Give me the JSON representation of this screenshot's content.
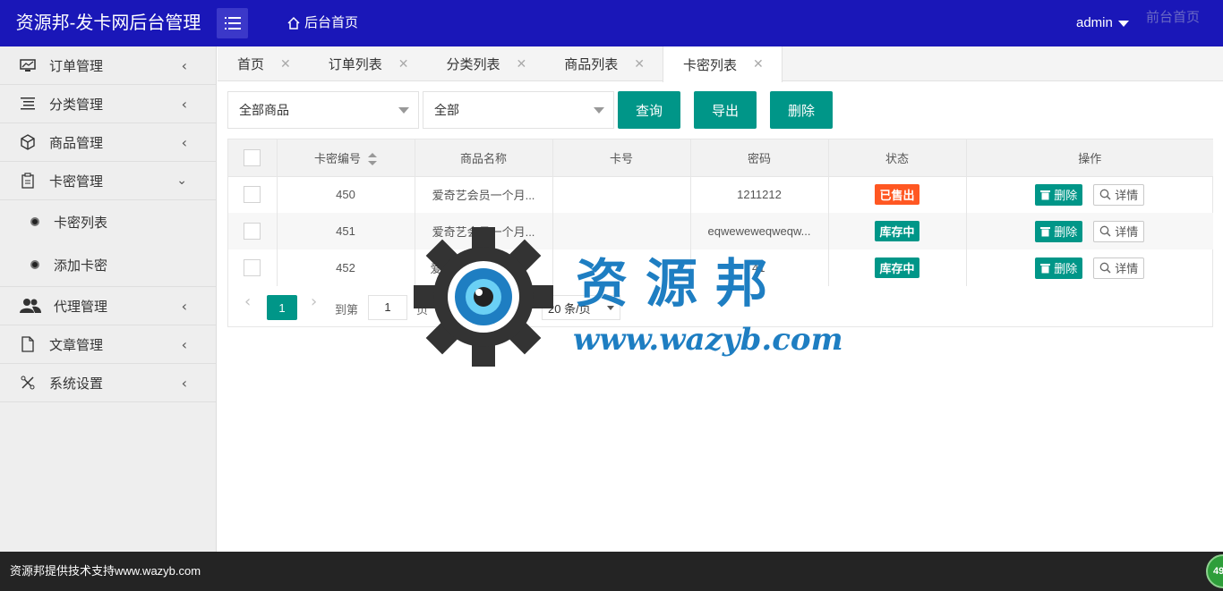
{
  "header": {
    "logo_text": "资源邦-发卡网后台管理",
    "home_label": "后台首页",
    "user_name": "admin",
    "front_link": "前台首页"
  },
  "sidebar": {
    "items": [
      {
        "label": "订单管理",
        "icon": "monitor-chart-icon"
      },
      {
        "label": "分类管理",
        "icon": "list-lines-icon"
      },
      {
        "label": "商品管理",
        "icon": "cube-icon"
      },
      {
        "label": "卡密管理",
        "icon": "clipboard-icon",
        "expanded": true
      },
      {
        "label": "代理管理",
        "icon": "users-icon"
      },
      {
        "label": "文章管理",
        "icon": "document-icon"
      },
      {
        "label": "系统设置",
        "icon": "tools-icon"
      }
    ],
    "subitems": [
      {
        "label": "卡密列表"
      },
      {
        "label": "添加卡密"
      }
    ]
  },
  "tabs": [
    {
      "label": "首页"
    },
    {
      "label": "订单列表"
    },
    {
      "label": "分类列表"
    },
    {
      "label": "商品列表"
    },
    {
      "label": "卡密列表",
      "active": true
    }
  ],
  "filters": {
    "product_select": "全部商品",
    "status_select": "全部"
  },
  "buttons": {
    "query": "查询",
    "export": "导出",
    "delete": "删除"
  },
  "table": {
    "columns": [
      "卡密编号",
      "商品名称",
      "卡号",
      "密码",
      "状态",
      "操作"
    ],
    "rows": [
      {
        "id": "450",
        "product": "爱奇艺会员一个月...",
        "card_no": "",
        "password": "1211212",
        "status": "已售出",
        "status_color": "#ff5722"
      },
      {
        "id": "451",
        "product": "爱奇艺会员一个月...",
        "card_no": "",
        "password": "eqwewewеqweqw...",
        "status": "库存中",
        "status_color": "#009688"
      },
      {
        "id": "452",
        "product": "爱奇艺会",
        "card_no": "",
        "password": "41",
        "status": "库存中",
        "status_color": "#009688"
      }
    ],
    "row_delete_label": "删除",
    "row_detail_label": "详情"
  },
  "pager": {
    "current_page": "1",
    "goto_label": "到第",
    "goto_value": "1",
    "page_label": "页",
    "confirm_label": "确定",
    "total_label": "共 3 条",
    "page_size": "20 条/页"
  },
  "watermark": {
    "title": "资源邦",
    "url": "www.wazyb.com"
  },
  "footer": {
    "text": "资源邦提供技术支持www.wazyb.com",
    "float_badge": "49"
  },
  "colors": {
    "header_bg": "#1a17b8",
    "accent": "#009688",
    "sold": "#ff5722",
    "footer_bg": "#242424"
  }
}
